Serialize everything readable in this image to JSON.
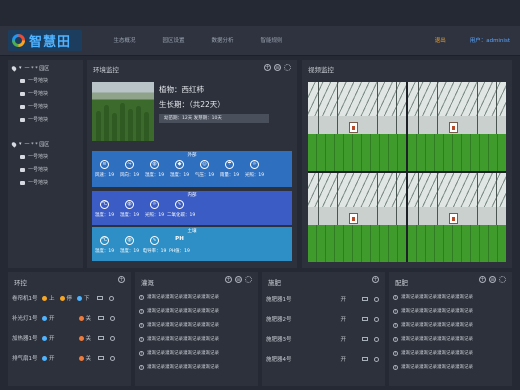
{
  "app": {
    "logo": "智慧田",
    "nav": [
      "生态概况",
      "园区设置",
      "数据分析",
      "智能规则"
    ],
    "logout": "退出",
    "user": "用户：administ"
  },
  "sidebar": {
    "groups": [
      {
        "label": "一 * * 园区",
        "items": [
          "一号地块",
          "一号地块",
          "一号地块",
          "一号地块"
        ]
      },
      {
        "label": "一 * * 园区",
        "items": [
          "一号地块",
          "一号地块",
          "一号地块"
        ]
      }
    ]
  },
  "env": {
    "title": "环境监控",
    "plant": "植物：西红柿",
    "growth": "生长期：（共22天）",
    "stage": "幼苗期：12天 发芽期：10天",
    "sections": [
      {
        "title": "外部",
        "sensors": [
          {
            "icon": "wind-icon",
            "glyph": "≋",
            "label": "风速：19"
          },
          {
            "icon": "wind-direction-icon",
            "glyph": "⤳",
            "label": "风向：19"
          },
          {
            "icon": "humidity-icon",
            "glyph": "◍",
            "label": "湿度：19"
          },
          {
            "icon": "droplet-icon",
            "glyph": "◆",
            "label": "湿度：19"
          },
          {
            "icon": "pressure-icon",
            "glyph": "◎",
            "label": "气压：19"
          },
          {
            "icon": "rain-icon",
            "glyph": "☂",
            "label": "雨量：19"
          },
          {
            "icon": "sun-icon",
            "glyph": "☼",
            "label": "光照：19"
          }
        ]
      },
      {
        "title": "内部",
        "sensors": [
          {
            "icon": "thermometer-icon",
            "glyph": "℃",
            "label": "温度：19"
          },
          {
            "icon": "humidity-icon",
            "glyph": "◍",
            "label": "湿度：19"
          },
          {
            "icon": "sun-icon",
            "glyph": "☼",
            "label": "光照：19"
          },
          {
            "icon": "co2-icon",
            "glyph": "∿",
            "label": "二氧化碳：19"
          }
        ]
      },
      {
        "title": "土壤",
        "sensors": [
          {
            "icon": "thermometer-icon",
            "glyph": "℃",
            "label": "温度：19"
          },
          {
            "icon": "humidity-icon",
            "glyph": "◍",
            "label": "湿度：19"
          },
          {
            "icon": "conductivity-icon",
            "glyph": "∿",
            "label": "电导率：19"
          },
          {
            "icon": "ph-icon",
            "glyph": "PH",
            "label": "PH值：19"
          }
        ]
      }
    ]
  },
  "video": {
    "title": "视频监控"
  },
  "env_control": {
    "title": "环控",
    "rows": [
      {
        "name": "卷帘机1号",
        "options": [
          {
            "label": "上",
            "color": "#f5a623"
          },
          {
            "label": "停",
            "color": "#f5a623"
          },
          {
            "label": "下",
            "color": "#4fb3ff"
          }
        ]
      },
      {
        "name": "补光灯1号",
        "options": [
          {
            "label": "开",
            "color": "#4fb3ff"
          },
          {
            "label": "关",
            "color": "#f07a3a"
          }
        ]
      },
      {
        "name": "加热器1号",
        "options": [
          {
            "label": "开",
            "color": "#4fb3ff"
          },
          {
            "label": "关",
            "color": "#f07a3a"
          }
        ]
      },
      {
        "name": "排气扇1号",
        "options": [
          {
            "label": "开",
            "color": "#4fb3ff"
          },
          {
            "label": "关",
            "color": "#f07a3a"
          }
        ]
      }
    ]
  },
  "irrigation": {
    "title": "灌溉",
    "logs": [
      "灌溉记录灌溉记录灌溉记录灌溉记录",
      "灌溉记录灌溉记录灌溉记录灌溉记录",
      "灌溉记录灌溉记录灌溉记录灌溉记录",
      "灌溉记录灌溉记录灌溉记录灌溉记录",
      "灌溉记录灌溉记录灌溉记录灌溉记录",
      "灌溉记录灌溉记录灌溉记录灌溉记录"
    ]
  },
  "fertilize": {
    "title": "施肥",
    "rows": [
      {
        "name": "施肥器1号",
        "state": "开"
      },
      {
        "name": "施肥器2号",
        "state": "开"
      },
      {
        "name": "施肥器3号",
        "state": "开"
      },
      {
        "name": "施肥器4号",
        "state": "开"
      }
    ]
  },
  "formula": {
    "title": "配肥",
    "logs": [
      "灌溉记录灌溉记录灌溉记录灌溉记录",
      "灌溉记录灌溉记录灌溉记录灌溉记录",
      "灌溉记录灌溉记录灌溉记录灌溉记录",
      "灌溉记录灌溉记录灌溉记录灌溉记录",
      "灌溉记录灌溉记录灌溉记录灌溉记录",
      "灌溉记录灌溉记录灌溉记录灌溉记录"
    ]
  }
}
